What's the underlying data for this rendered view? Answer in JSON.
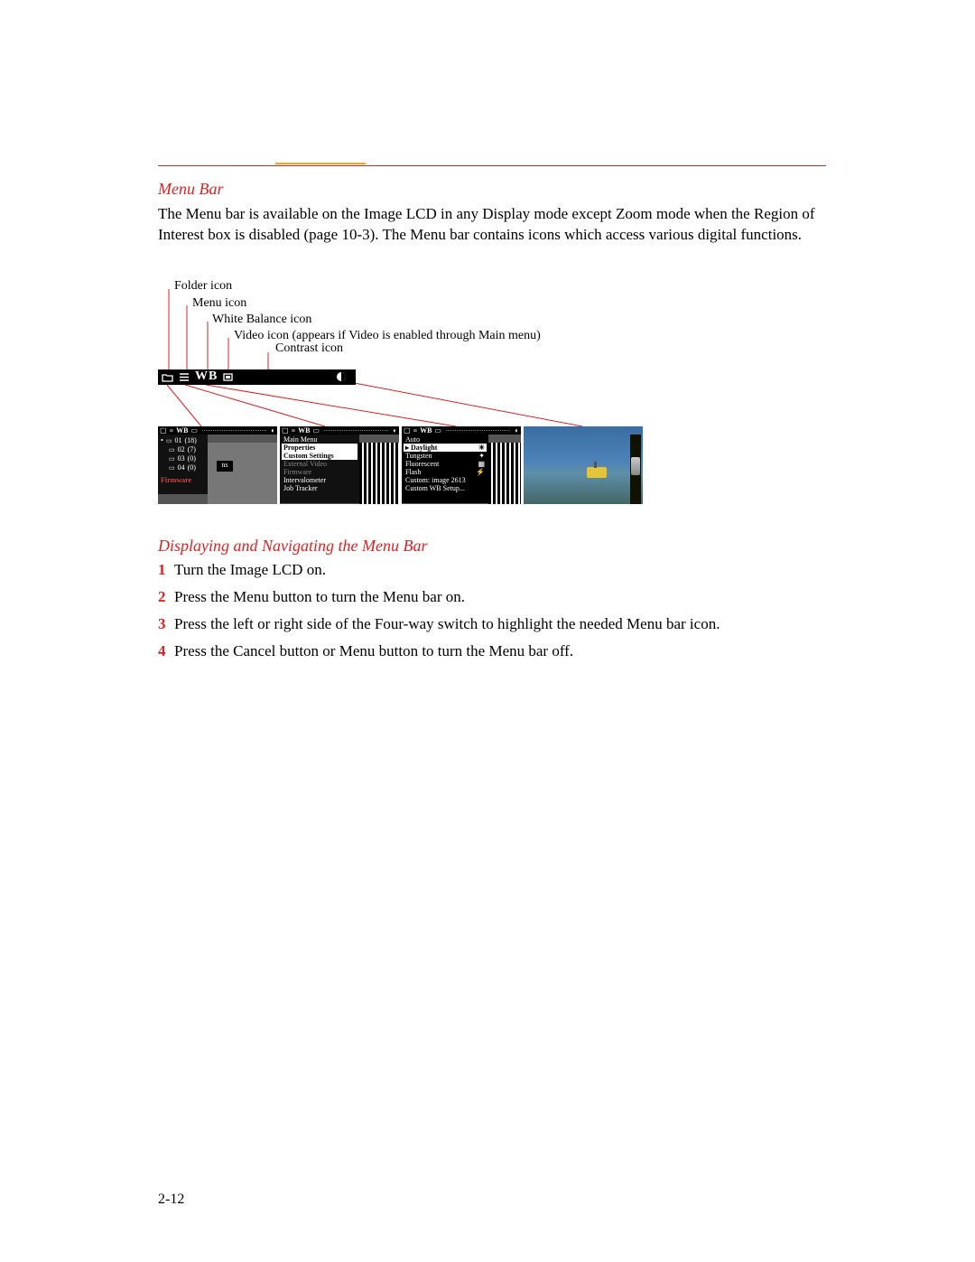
{
  "sections": {
    "menuBar": {
      "title": "Menu Bar",
      "intro": "The Menu bar is available on the Image LCD in any Display mode except Zoom mode when the Region of Interest box is disabled (page 10-3). The Menu bar contains icons which access various digital functions."
    },
    "navigation": {
      "title": "Displaying and Navigating the Menu Bar",
      "steps": [
        "Turn the Image LCD on.",
        "Press the Menu button to turn the Menu bar on.",
        "Press the left or right side of the Four-way switch to highlight the needed Menu bar icon.",
        "Press the Cancel button or Menu button to turn the Menu bar off."
      ]
    }
  },
  "callouts": {
    "folder": "Folder icon",
    "menu": "Menu icon",
    "wb": "White Balance icon",
    "video": "Video icon (appears if Video is enabled through Main menu)",
    "contrast": "Contrast icon"
  },
  "barLabel": "WB",
  "thumbs": {
    "folderList": {
      "rows": [
        {
          "name": "01",
          "count": "(18)",
          "selected": true
        },
        {
          "name": "02",
          "count": "(7)"
        },
        {
          "name": "03",
          "count": "(0)"
        },
        {
          "name": "04",
          "count": "(0)"
        }
      ],
      "firmware": "Firmware",
      "sideLabel": "ns"
    },
    "mainMenu": {
      "items": [
        {
          "label": "Main Menu",
          "state": "normal"
        },
        {
          "label": "Properties",
          "state": "sel"
        },
        {
          "label": "Custom Settings",
          "state": "sel"
        },
        {
          "label": "External Video",
          "state": "dim"
        },
        {
          "label": "Firmware",
          "state": "dim"
        },
        {
          "label": "Intervalometer",
          "state": "normal"
        },
        {
          "label": "Job Tracker",
          "state": "normal"
        }
      ]
    },
    "wbMenu": {
      "items": [
        {
          "label": "Auto",
          "icon": ""
        },
        {
          "label": "Daylight",
          "icon": "☀",
          "sel": true
        },
        {
          "label": "Tungsten",
          "icon": "✦"
        },
        {
          "label": "Fluorescent",
          "icon": "▦"
        },
        {
          "label": "Flash",
          "icon": "⚡"
        },
        {
          "label": "Custom: image 2613",
          "icon": ""
        },
        {
          "label": "Custom WB Setup...",
          "icon": ""
        }
      ]
    }
  },
  "pageNumber": "2-12"
}
